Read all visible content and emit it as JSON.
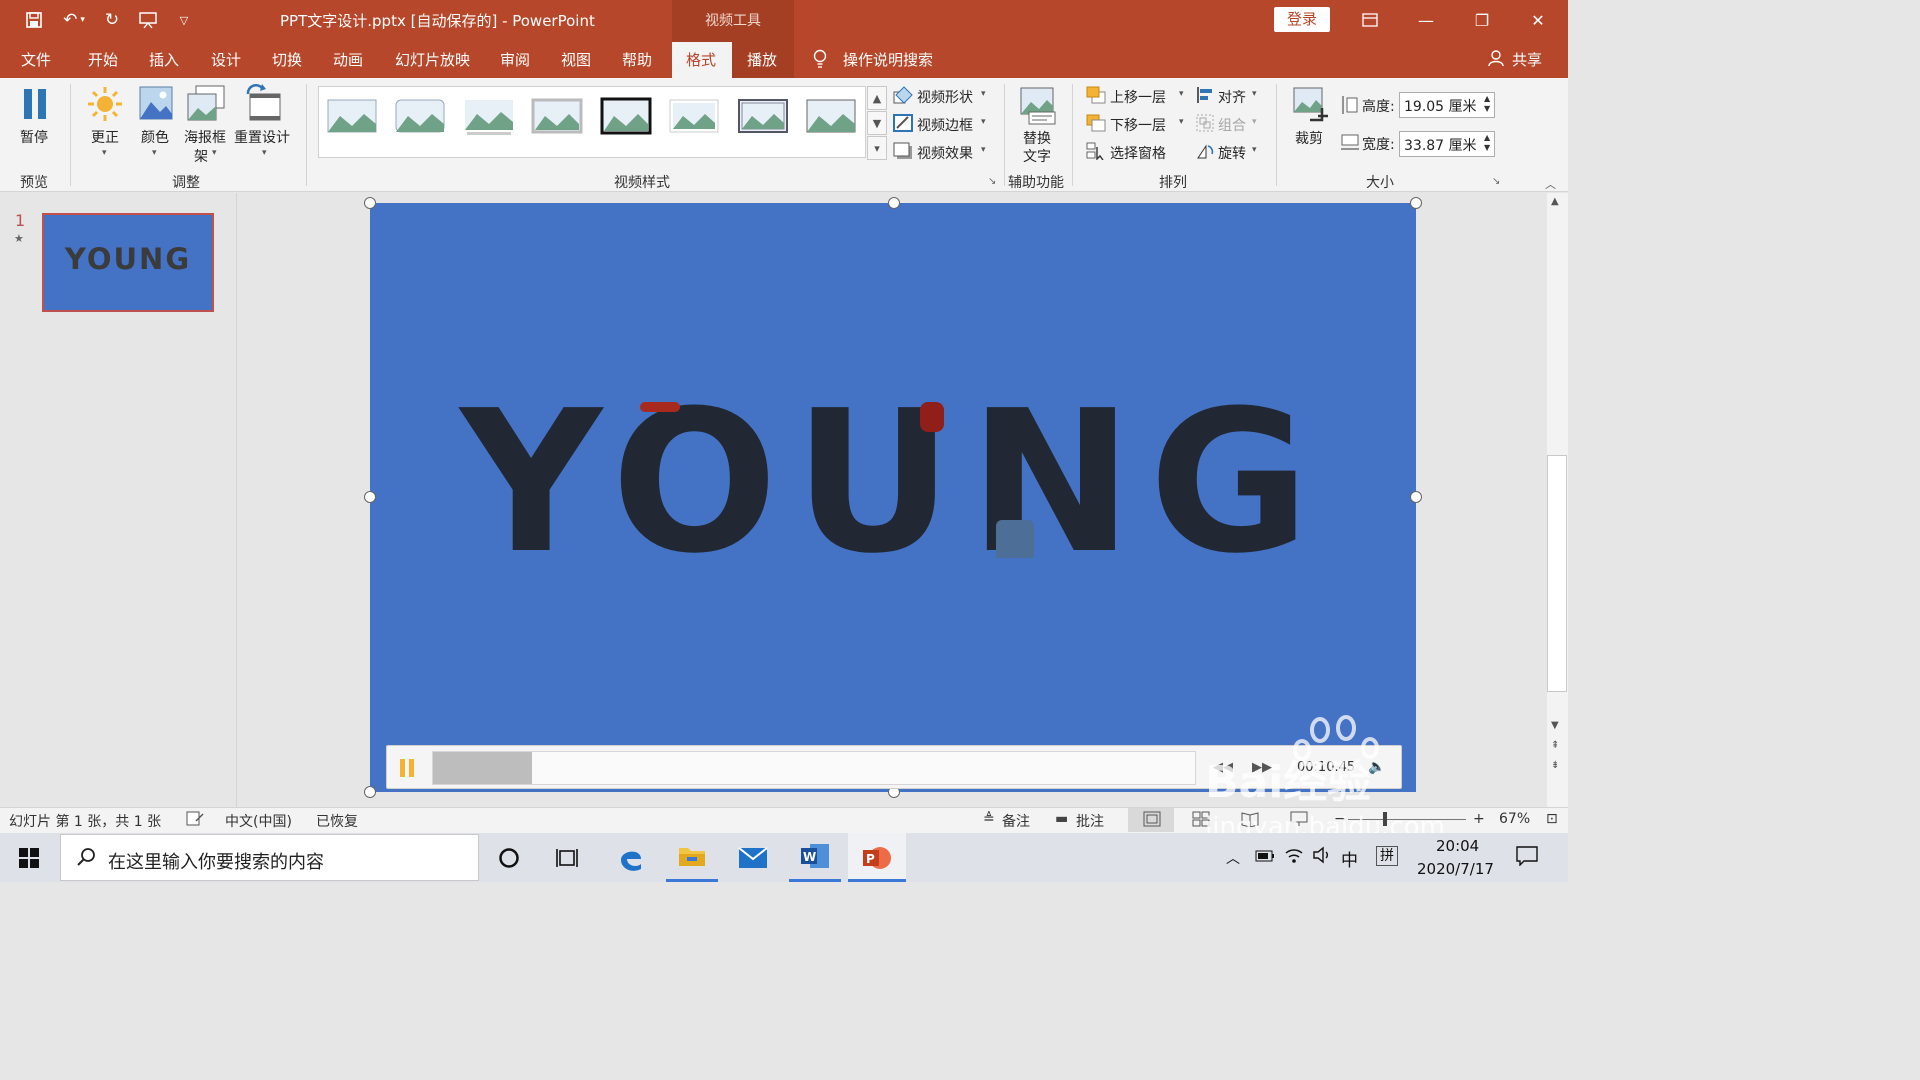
{
  "window": {
    "title": "PPT文字设计.pptx [自动保存的]  -  PowerPoint",
    "context_group": "视频工具",
    "login": "登录"
  },
  "tabs": {
    "file": "文件",
    "home": "开始",
    "insert": "插入",
    "design": "设计",
    "transitions": "切换",
    "animations": "动画",
    "slideshow": "幻灯片放映",
    "review": "审阅",
    "view": "视图",
    "help": "帮助",
    "format": "格式",
    "playback": "播放",
    "tellme": "操作说明搜索",
    "share": "共享"
  },
  "ribbon": {
    "preview": {
      "pause": "暂停",
      "group": "预览"
    },
    "adjust": {
      "corrections": "更正",
      "color": "颜色",
      "poster1": "海报框",
      "poster2": "架",
      "reset": "重置设计",
      "group": "调整"
    },
    "styles": {
      "shape": "视频形状",
      "border": "视频边框",
      "effects": "视频效果",
      "group": "视频样式"
    },
    "accessibility": {
      "alt1": "替换",
      "alt2": "文字",
      "group": "辅助功能"
    },
    "arrange": {
      "forward": "上移一层",
      "backward": "下移一层",
      "pane": "选择窗格",
      "align": "对齐",
      "grouping": "组合",
      "rotate": "旋转",
      "group": "排列"
    },
    "size": {
      "crop": "裁剪",
      "height_label": "高度:",
      "height_value": "19.05 厘米",
      "width_label": "宽度:",
      "width_value": "33.87 厘米",
      "group": "大小"
    }
  },
  "thumbnails": {
    "slide_number": "1",
    "star": "★",
    "text": "YOUNG"
  },
  "slide": {
    "text": "YOUNG"
  },
  "player": {
    "time": "00:10.45",
    "progress": 0.13
  },
  "status": {
    "slide_info": "幻灯片 第 1 张，共 1 张",
    "language": "中文(中国)",
    "recovered": "已恢复",
    "notes": "备注",
    "comments": "批注",
    "zoom": "67%"
  },
  "taskbar": {
    "search_placeholder": "在这里输入你要搜索的内容",
    "time": "20:04",
    "date": "2020/7/17",
    "ime1": "中",
    "ime2": "拼"
  },
  "watermark": {
    "line1": "Bai经验",
    "line2": "jingyan.baidu.com"
  },
  "colors": {
    "accent": "#b7472a",
    "slide_bg": "#4472c4",
    "taskbar": "#dfe1e8"
  }
}
